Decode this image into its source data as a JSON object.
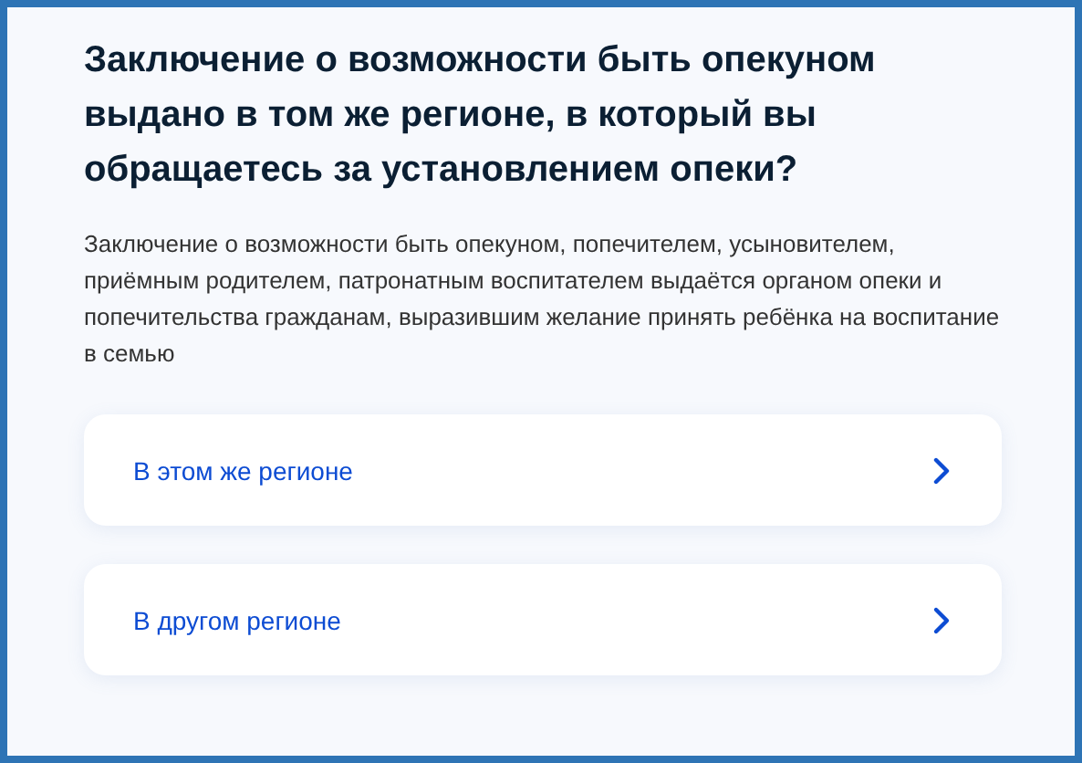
{
  "question": {
    "title": "Заключение о возможности быть опекуном выдано в том же регионе, в который вы обращаетесь за установлением опеки?",
    "description": "Заключение о возможности быть опекуном, попечителем, усыновителем, приёмным родителем, патронатным воспитателем выдаётся органом опеки и попечительства гражданам, выразившим желание принять ребёнка на воспитание в семью"
  },
  "options": [
    {
      "label": "В этом же регионе"
    },
    {
      "label": "В другом регионе"
    }
  ]
}
